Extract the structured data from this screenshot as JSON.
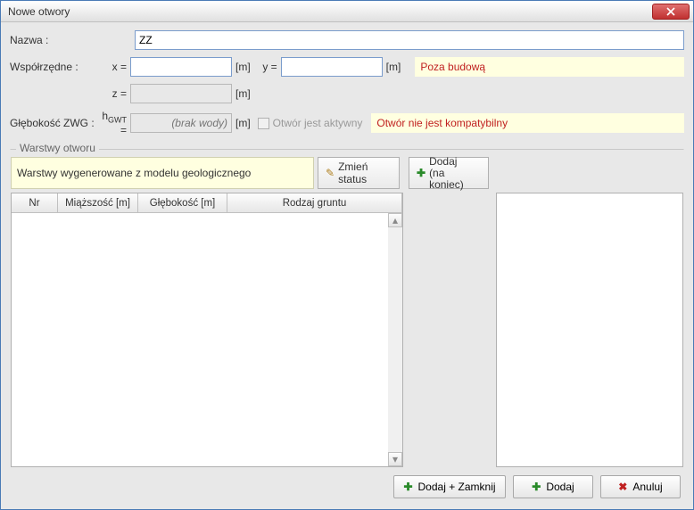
{
  "window": {
    "title": "Nowe otwory"
  },
  "fields": {
    "name_label": "Nazwa :",
    "name_value": "ZZ",
    "coords_label": "Współrzędne :",
    "x_label": "x =",
    "x_value": "",
    "y_label": "y =",
    "y_value": "",
    "z_label": "z =",
    "z_value": "",
    "unit_m": "[m]",
    "depth_label": "Głębokość ZWG :",
    "hgwt_label_prefix": "h",
    "hgwt_label_sub": "GWT",
    "hgwt_label_suffix": " =",
    "hgwt_placeholder": "(brak wody)",
    "active_label": "Otwór jest aktywny"
  },
  "warnings": {
    "outside": "Poza budową",
    "incompatible": "Otwór nie jest kompatybilny"
  },
  "layers": {
    "legend": "Warstwy otworu",
    "status_text": "Warstwy wygenerowane z modelu geologicznego",
    "change_status": "Zmień status",
    "add_end_line1": "Dodaj",
    "add_end_line2": "(na koniec)",
    "columns": {
      "nr": "Nr",
      "thickness": "Miąższość [m]",
      "depth": "Głębokość [m]",
      "soil": "Rodzaj gruntu"
    }
  },
  "footer": {
    "add_close": "Dodaj + Zamknij",
    "add": "Dodaj",
    "cancel": "Anuluj"
  }
}
